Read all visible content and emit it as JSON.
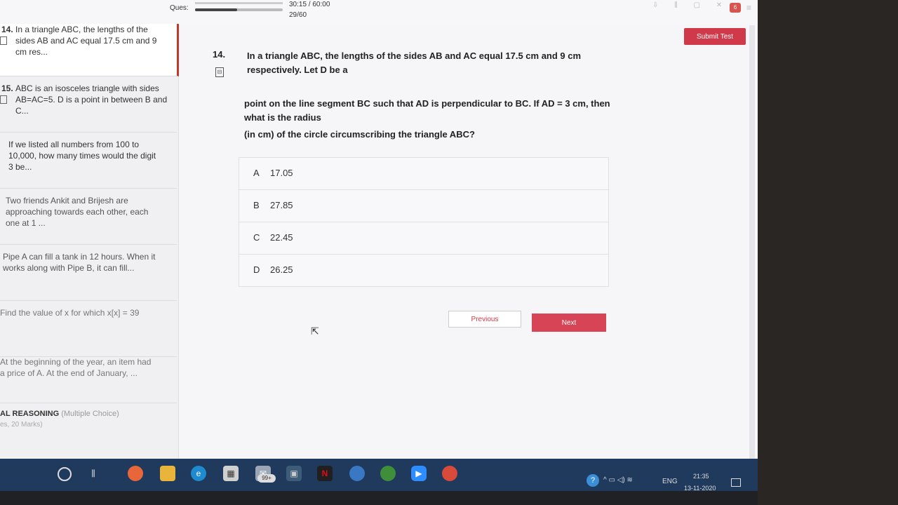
{
  "header": {
    "ques_label": "Ques:",
    "timer": "30:15 / 60:00",
    "question_count": "29/60",
    "progress_fraction": 0.48,
    "notification_count": "6",
    "submit_label": "Submit Test"
  },
  "sidebar": {
    "items": [
      {
        "num": "14.",
        "text": "In a triangle ABC, the lengths of the sides AB and AC equal 17.5 cm and 9 cm res..."
      },
      {
        "num": "15.",
        "text": "ABC is an isosceles triangle with sides AB=AC=5. D is a point in between B and C..."
      },
      {
        "num": "",
        "text": "If we listed all numbers from 100 to 10,000, how many times would the digit 3 be..."
      },
      {
        "num": "",
        "text": "Two friends Ankit and Brijesh are approaching towards each other, each one at 1 ..."
      },
      {
        "num": "",
        "text": "Pipe A can fill a tank in 12 hours. When it works along with Pipe B, it can fill..."
      },
      {
        "num": "",
        "text": "Find the value of x for which x[x] = 39"
      },
      {
        "num": "",
        "text": "At the beginning of the year, an item had a price of A. At the end of January, ..."
      }
    ],
    "section_title": "AL REASONING",
    "section_type": "(Multiple Choice)",
    "section_sub": "es, 20 Marks)"
  },
  "question": {
    "number": "14.",
    "line1": "In a triangle ABC, the lengths of the sides AB and AC equal 17.5 cm and 9 cm respectively. Let D be a",
    "line2": "point on the line segment BC such that AD is perpendicular to BC. If AD = 3 cm, then what is the radius",
    "line3": "(in cm) of the circle circumscribing the triangle ABC?",
    "options": [
      {
        "letter": "A",
        "value": "17.05"
      },
      {
        "letter": "B",
        "value": "27.85"
      },
      {
        "letter": "C",
        "value": "22.45"
      },
      {
        "letter": "D",
        "value": "26.25"
      }
    ],
    "prev_label": "Previous",
    "next_label": "Next"
  },
  "taskbar": {
    "mail_badge": "99+",
    "netflix_letter": "N",
    "tray_lang": "ENG",
    "time": "21:35",
    "date": "13-11-2020"
  },
  "colors": {
    "accent": "#d0394a",
    "taskbar": "#1f3a5c"
  }
}
